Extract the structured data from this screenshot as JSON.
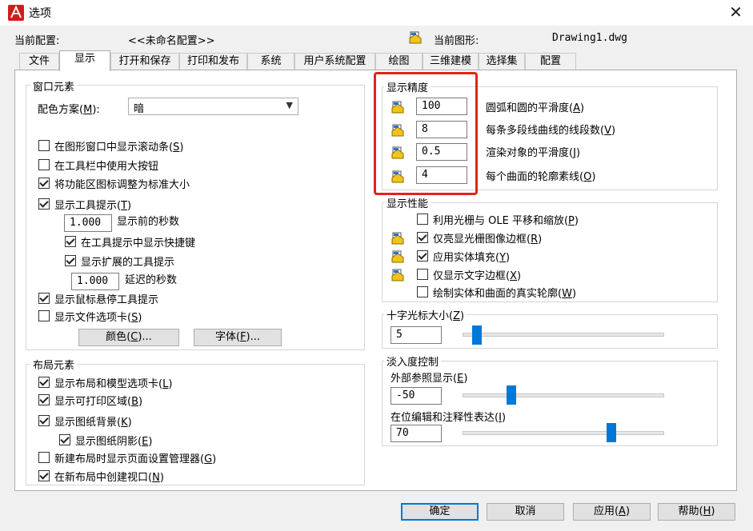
{
  "window": {
    "title": "选项",
    "close_glyph": "✕"
  },
  "header": {
    "profile_label": "当前配置:",
    "profile_value": "<<未命名配置>>",
    "drawing_label": "当前图形:",
    "drawing_value": "Drawing1.dwg"
  },
  "tabs": [
    "文件",
    "显示",
    "打开和保存",
    "打印和发布",
    "系统",
    "用户系统配置",
    "绘图",
    "三维建模",
    "选择集",
    "配置"
  ],
  "active_tab": "显示",
  "window_elements": {
    "title": "窗口元素",
    "color_scheme_label": "配色方案",
    "color_scheme_hotkey": "M",
    "color_scheme_value": "暗",
    "items": [
      {
        "text": "在图形窗口中显示滚动条",
        "key": "S",
        "checked": false
      },
      {
        "text": "在工具栏中使用大按钮",
        "key": "",
        "checked": false
      },
      {
        "text": "将功能区图标调整为标准大小",
        "key": "",
        "checked": true
      },
      {
        "text": "显示工具提示",
        "key": "T",
        "checked": true
      },
      {
        "text": "在工具提示中显示快捷键",
        "key": "",
        "checked": true
      },
      {
        "text": "显示扩展的工具提示",
        "key": "",
        "checked": true
      },
      {
        "text": "显示鼠标悬停工具提示",
        "key": "",
        "checked": true
      },
      {
        "text": "显示文件选项卡",
        "key": "S",
        "checked": false
      }
    ],
    "delay_value": "1.000",
    "delay_label": "显示前的秒数",
    "ext_delay_value": "1.000",
    "ext_delay_label": "延迟的秒数",
    "colors_button": "颜色",
    "colors_key": "C",
    "fonts_button": "字体",
    "fonts_key": "F"
  },
  "layout_elements": {
    "title": "布局元素",
    "items": [
      {
        "text": "显示布局和模型选项卡",
        "key": "L",
        "checked": true
      },
      {
        "text": "显示可打印区域",
        "key": "B",
        "checked": true
      },
      {
        "text": "显示图纸背景",
        "key": "K",
        "checked": true
      },
      {
        "text": "显示图纸阴影",
        "key": "E",
        "checked": true
      },
      {
        "text": "新建布局时显示页面设置管理器",
        "key": "G",
        "checked": false
      },
      {
        "text": "在新布局中创建视口",
        "key": "N",
        "checked": true
      }
    ]
  },
  "display_resolution": {
    "title": "显示精度",
    "items": [
      {
        "value": "100",
        "text": "圆弧和圆的平滑度",
        "key": "A"
      },
      {
        "value": "8",
        "text": "每条多段线曲线的线段数",
        "key": "V"
      },
      {
        "value": "0.5",
        "text": "渲染对象的平滑度",
        "key": "J"
      },
      {
        "value": "4",
        "text": "每个曲面的轮廓素线",
        "key": "O"
      }
    ]
  },
  "display_performance": {
    "title": "显示性能",
    "items": [
      {
        "text": "利用光栅与 OLE 平移和缩放",
        "key": "P",
        "checked": false,
        "icon": false
      },
      {
        "text": "仅亮显光栅图像边框",
        "key": "R",
        "checked": true,
        "icon": true
      },
      {
        "text": "应用实体填充",
        "key": "Y",
        "checked": true,
        "icon": true
      },
      {
        "text": "仅显示文字边框",
        "key": "X",
        "checked": false,
        "icon": true
      },
      {
        "text": "绘制实体和曲面的真实轮廓",
        "key": "W",
        "checked": false,
        "icon": false
      }
    ]
  },
  "crosshair": {
    "title": "十字光标大小",
    "key": "Z",
    "value": "5",
    "slider_fraction": 0.05
  },
  "fade": {
    "title": "淡入度控制",
    "xref_label": "外部参照显示",
    "xref_key": "E",
    "xref_value": "-50",
    "xref_fraction": 0.23,
    "inplace_label": "在位编辑和注释性表达",
    "inplace_key": "I",
    "inplace_value": "70",
    "inplace_fraction": 0.75
  },
  "buttons": {
    "ok": "确定",
    "cancel": "取消",
    "apply": "应用",
    "apply_key": "A",
    "help": "帮助",
    "help_key": "H"
  },
  "colors": {
    "accent": "#0078d7",
    "highlight": "#e0241b",
    "app_icon": "#d21c1c",
    "drawing_icon": "#f2c31b"
  }
}
